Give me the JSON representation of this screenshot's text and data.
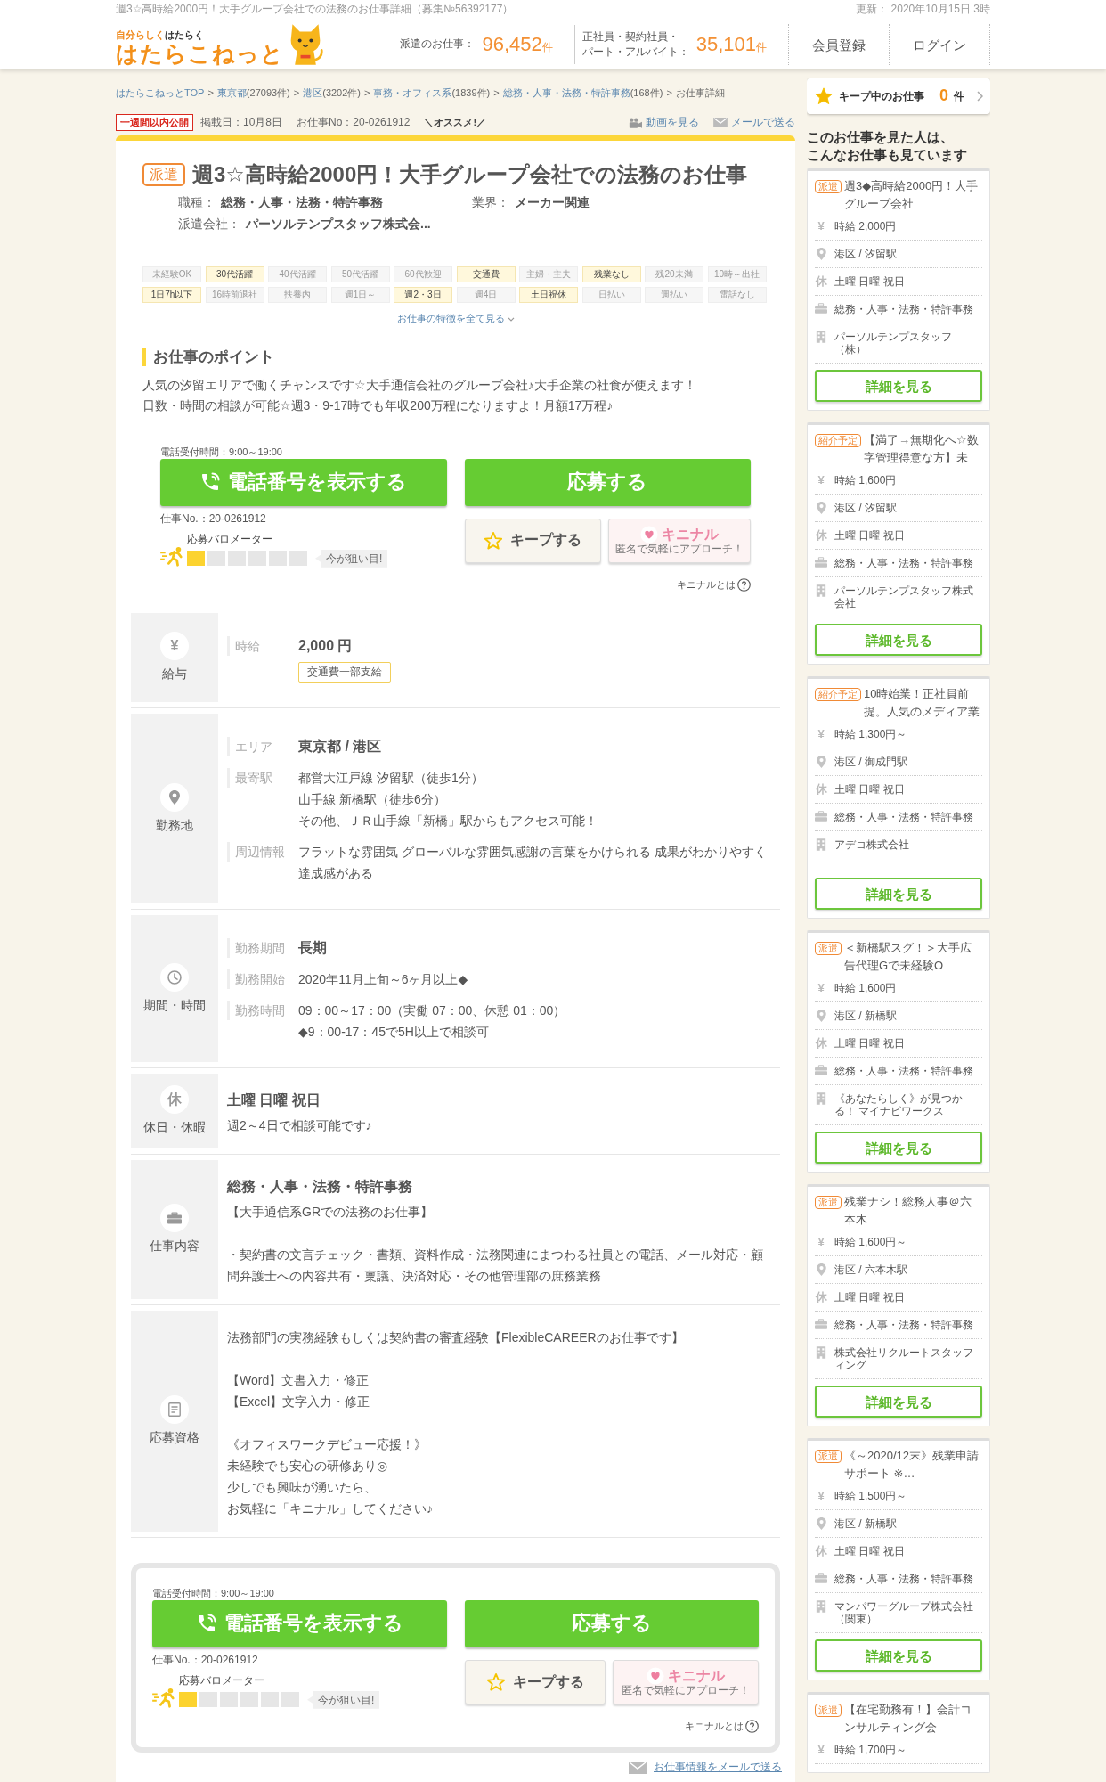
{
  "top_strip": {
    "page_title": "週3☆高時給2000円！大手グループ会社での法務のお仕事詳細（募集№56392177）",
    "updated": "更新： 2020年10月15日 3時"
  },
  "header": {
    "tagline_accent": "自分らしく",
    "tagline_rest": "はたらく",
    "logo_text": "はたらこねっと",
    "stats": [
      {
        "label_lines": [
          "派遣のお仕事："
        ],
        "count": "96,452",
        "unit": "件"
      },
      {
        "label_lines": [
          "正社員・契約社員・",
          "パート・アルバイト："
        ],
        "count": "35,101",
        "unit": "件"
      }
    ],
    "nav": [
      "会員登録",
      "ログイン"
    ]
  },
  "breadcrumb": {
    "separator": ">",
    "items": [
      {
        "text": "はたらこねっとTOP",
        "link": true
      },
      {
        "text": "東京都",
        "count": "(27093件)",
        "link": true
      },
      {
        "text": "港区",
        "count": "(3202件)",
        "link": true
      },
      {
        "text": "事務・オフィス系",
        "count": "(1839件)",
        "link": true
      },
      {
        "text": "総務・人事・法務・特許事務",
        "count": "(168件)",
        "link": true
      },
      {
        "text": "お仕事詳細",
        "link": false
      }
    ]
  },
  "job_meta": {
    "new_badge": "一週間以内公開",
    "posted": "掲載日：10月8日",
    "job_no": "お仕事No：20-0261912",
    "recommend": "＼オススメ!／",
    "links": [
      {
        "kind": "video",
        "text": "動画を見る"
      },
      {
        "kind": "mail",
        "text": "メールで送る"
      }
    ]
  },
  "job": {
    "type_badge": "派遣",
    "title": "週3☆高時給2000円！大手グループ会社での法務のお仕事",
    "fields": [
      {
        "label": "職種：",
        "value": "総務・人事・法務・特許事務"
      },
      {
        "label": "業界：",
        "value": "メーカー関連"
      },
      {
        "label": "派遣会社：",
        "value": "パーソルテンプスタッフ株式会..."
      }
    ]
  },
  "features": {
    "tags": [
      {
        "label": "未経験OK",
        "on": false
      },
      {
        "label": "30代活躍",
        "on": true
      },
      {
        "label": "40代活躍",
        "on": false
      },
      {
        "label": "50代活躍",
        "on": false
      },
      {
        "label": "60代歓迎",
        "on": false
      },
      {
        "label": "交通費",
        "on": true
      },
      {
        "label": "主婦・主夫",
        "on": false
      },
      {
        "label": "残業なし",
        "on": true
      },
      {
        "label": "残20未満",
        "on": false
      },
      {
        "label": "10時～出社",
        "on": false
      },
      {
        "label": "1日7h以下",
        "on": true
      },
      {
        "label": "16時前退社",
        "on": false
      },
      {
        "label": "扶養内",
        "on": false
      },
      {
        "label": "週1日～",
        "on": false
      },
      {
        "label": "週2・3日",
        "on": true
      },
      {
        "label": "週4日",
        "on": false
      },
      {
        "label": "土日祝休",
        "on": true
      },
      {
        "label": "日払い",
        "on": false
      },
      {
        "label": "週払い",
        "on": false
      },
      {
        "label": "電話なし",
        "on": false
      }
    ],
    "more_link": "お仕事の特徴を全て見る"
  },
  "points": {
    "heading": "お仕事のポイント",
    "lines": [
      "人気の汐留エリアで働くチャンスです☆大手通信会社のグループ会社♪大手企業の社食が使えます！",
      "日数・時間の相談が可能☆週3・9-17時でも年収200万程になりますよ！月額17万程♪"
    ]
  },
  "apply_boxes": [
    {
      "kind": "inline",
      "phone_hours": "電話受付時間：9:00～19:00",
      "phone_button": "電話番号を表示する",
      "apply_button": "応募する",
      "job_no": "仕事No.：20-0261912",
      "barometer": {
        "label": "応募バロメーター",
        "level": 0.1667,
        "tip": "今が狙い目!"
      },
      "keep_button": "キープする",
      "kininal": {
        "label": "キニナル",
        "sub": "匿名で気軽にアプローチ！"
      },
      "help": "キニナルとは"
    },
    {
      "kind": "framed",
      "phone_hours": "電話受付時間：9:00～19:00",
      "phone_button": "電話番号を表示する",
      "apply_button": "応募する",
      "job_no": "仕事No.：20-0261912",
      "barometer": {
        "label": "応募バロメーター",
        "level": 0.1667,
        "tip": "今が狙い目!"
      },
      "keep_button": "キープする",
      "kininal": {
        "label": "キニナル",
        "sub": "匿名で気軽にアプローチ！"
      },
      "help": "キニナルとは"
    }
  ],
  "details": [
    {
      "kind": "salary",
      "mark": "¥",
      "label": "給与",
      "fields": [
        {
          "label": "時給",
          "lines": [
            "2,000 円"
          ],
          "bold": true,
          "badge": "交通費一部支給"
        }
      ]
    },
    {
      "kind": "location",
      "label": "勤務地",
      "fields": [
        {
          "label": "エリア",
          "lines": [
            "東京都 / 港区"
          ],
          "bold": true
        },
        {
          "label": "最寄駅",
          "lines": [
            "都営大江戸線 汐留駅（徒歩1分）",
            "山手線 新橋駅（徒歩6分）",
            "その他、ＪＲ山手線「新橋」駅からもアクセス可能！"
          ],
          "bold": false
        },
        {
          "label": "周辺情報",
          "lines": [
            "フラットな雰囲気 グローバルな雰囲気感謝の言葉をかけられる 成果がわかりやすく達成感がある"
          ],
          "bold": false
        }
      ]
    },
    {
      "kind": "period",
      "label": "期間・時間",
      "fields": [
        {
          "label": "勤務期間",
          "lines": [
            "長期"
          ],
          "bold": true
        },
        {
          "label": "勤務開始",
          "lines": [
            "2020年11月上旬～6ヶ月以上◆"
          ],
          "bold": false
        },
        {
          "label": "勤務時間",
          "lines": [
            "09：00～17：00（実働 07：00、休憩 01：00）",
            "◆9：00-17：45で5H以上で相談可"
          ],
          "bold": false
        }
      ]
    },
    {
      "kind": "holiday",
      "mark": "休",
      "label": "休日・休暇",
      "heading": "土曜 日曜 祝日",
      "paragraphs": [
        [
          "週2～4日で相談可能です♪"
        ]
      ]
    },
    {
      "kind": "job",
      "label": "仕事内容",
      "heading": "総務・人事・法務・特許事務",
      "paragraphs": [
        [
          "【大手通信系GRでの法務のお仕事】"
        ],
        [
          "・契約書の文言チェック・書類、資料作成・法務関連にまつわる社員との電話、メール対応・顧問弁護士への内容共有・稟議、決済対応・その他管理部の庶務業務"
        ]
      ]
    },
    {
      "kind": "qualification",
      "label": "応募資格",
      "paragraphs": [
        [
          "法務部門の実務経験もしくは契約書の審査経験【FlexibleCAREERのお仕事です】"
        ],
        [
          "【Word】文書入力・修正",
          "【Excel】文字入力・修正"
        ],
        [
          "《オフィスワークデビュー応援！》",
          "未経験でも安心の研修あり◎",
          "少しでも興味が湧いたら、",
          "お気軽に「キニナル」してください♪"
        ]
      ]
    }
  ],
  "mail_link": "お仕事情報をメールで送る",
  "sidebar": {
    "keep": {
      "label": "キープ中のお仕事",
      "count": "0",
      "unit": "件"
    },
    "heading_lines": [
      "このお仕事を見た人は、",
      "こんなお仕事も見ています"
    ],
    "cards": [
      {
        "badge": "派遣",
        "title": "週3◆高時給2000円！大手グループ会社",
        "rows": [
          {
            "kind": "salary",
            "mark": "¥",
            "text": "時給 2,000円"
          },
          {
            "kind": "location",
            "text": "港区 / 汐留駅"
          },
          {
            "kind": "holiday",
            "mark": "休",
            "text": "土曜 日曜 祝日"
          },
          {
            "kind": "job",
            "text": "総務・人事・法務・特許事務"
          },
          {
            "kind": "company",
            "text": "パーソルテンプスタッフ（株）"
          }
        ],
        "button": "詳細を見る"
      },
      {
        "badge": "紹介予定",
        "title": "【満了→無期化へ☆数字管理得意な方】未",
        "rows": [
          {
            "kind": "salary",
            "mark": "¥",
            "text": "時給 1,600円"
          },
          {
            "kind": "location",
            "text": "港区 / 汐留駅"
          },
          {
            "kind": "holiday",
            "mark": "休",
            "text": "土曜 日曜 祝日"
          },
          {
            "kind": "job",
            "text": "総務・人事・法務・特許事務"
          },
          {
            "kind": "company",
            "text": "パーソルテンプスタッフ株式会社"
          }
        ],
        "button": "詳細を見る"
      },
      {
        "badge": "紹介予定",
        "title": "10時始業！正社員前提。人気のメディア業",
        "rows": [
          {
            "kind": "salary",
            "mark": "¥",
            "text": "時給 1,300円～"
          },
          {
            "kind": "location",
            "text": "港区 / 御成門駅"
          },
          {
            "kind": "holiday",
            "mark": "休",
            "text": "土曜 日曜 祝日"
          },
          {
            "kind": "job",
            "text": "総務・人事・法務・特許事務"
          },
          {
            "kind": "company",
            "text": "アデコ株式会社"
          }
        ],
        "button": "詳細を見る"
      },
      {
        "badge": "派遣",
        "title": "＜新橋駅スグ！＞大手広告代理Gで未経験O",
        "rows": [
          {
            "kind": "salary",
            "mark": "¥",
            "text": "時給 1,600円"
          },
          {
            "kind": "location",
            "text": "港区 / 新橋駅"
          },
          {
            "kind": "holiday",
            "mark": "休",
            "text": "土曜 日曜 祝日"
          },
          {
            "kind": "job",
            "text": "総務・人事・法務・特許事務"
          },
          {
            "kind": "company",
            "text": "《あなたらしく》が見つかる！ マイナビワークス"
          }
        ],
        "button": "詳細を見る"
      },
      {
        "badge": "派遣",
        "title": "残業ナシ！総務人事＠六本木",
        "rows": [
          {
            "kind": "salary",
            "mark": "¥",
            "text": "時給 1,600円～"
          },
          {
            "kind": "location",
            "text": "港区 / 六本木駅"
          },
          {
            "kind": "holiday",
            "mark": "休",
            "text": "土曜 日曜 祝日"
          },
          {
            "kind": "job",
            "text": "総務・人事・法務・特許事務"
          },
          {
            "kind": "company",
            "text": "株式会社リクルートスタッフィング"
          }
        ],
        "button": "詳細を見る"
      },
      {
        "badge": "派遣",
        "title": "《～2020/12末》残業申請サポート ※…",
        "rows": [
          {
            "kind": "salary",
            "mark": "¥",
            "text": "時給 1,500円～"
          },
          {
            "kind": "location",
            "text": "港区 / 新橋駅"
          },
          {
            "kind": "holiday",
            "mark": "休",
            "text": "土曜 日曜 祝日"
          },
          {
            "kind": "job",
            "text": "総務・人事・法務・特許事務"
          },
          {
            "kind": "company",
            "text": "マンパワーグループ株式会社（関東）"
          }
        ],
        "button": "詳細を見る"
      },
      {
        "badge": "派遣",
        "title": "【在宅勤務有！】会計コンサルティング会",
        "rows": [
          {
            "kind": "salary",
            "mark": "¥",
            "text": "時給 1,700円～"
          }
        ]
      }
    ]
  }
}
